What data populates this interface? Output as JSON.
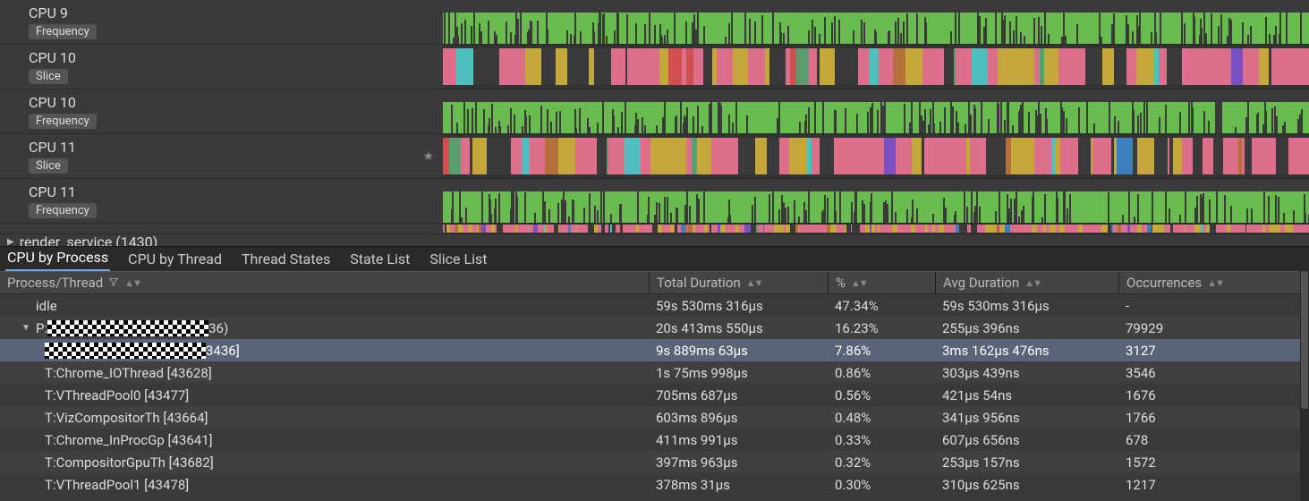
{
  "tracks": [
    {
      "title": "CPU 9",
      "badge": "Frequency",
      "type": "freq"
    },
    {
      "title": "CPU 10",
      "badge": "Slice",
      "type": "slice"
    },
    {
      "title": "CPU 10",
      "badge": "Frequency",
      "type": "freq"
    },
    {
      "title": "CPU 11",
      "badge": "Slice",
      "type": "slice",
      "starred": true
    },
    {
      "title": "CPU 11",
      "badge": "Frequency",
      "type": "freq"
    }
  ],
  "render_row": "render_service (1430)",
  "tabs": {
    "items": [
      "CPU by Process",
      "CPU by Thread",
      "Thread States",
      "State List",
      "Slice List"
    ],
    "active": 0
  },
  "columns": {
    "name": "Process/Thread",
    "dur": "Total Duration",
    "pct": "%",
    "avg": "Avg Duration",
    "occ": "Occurrences"
  },
  "rows": [
    {
      "name": "idle",
      "dur": "59s 530ms 316µs",
      "pct": "47.34%",
      "avg": "59s 530ms 316µs",
      "occ": "-",
      "depth": 1,
      "expander": "",
      "selected": false
    },
    {
      "name_prefix": "P:",
      "redacted": true,
      "name_suffix": "36)",
      "dur": "20s 413ms 550µs",
      "pct": "16.23%",
      "avg": "255µs 396ns",
      "occ": "79929",
      "depth": 1,
      "expander": "▼",
      "selected": false
    },
    {
      "name_prefix": "",
      "redacted": true,
      "name_suffix": "3436]",
      "dur": "9s 889ms 63µs",
      "pct": "7.86%",
      "avg": "3ms 162µs 476ns",
      "occ": "3127",
      "depth": 2,
      "expander": "",
      "selected": true
    },
    {
      "name": "T:Chrome_IOThread [43628]",
      "dur": "1s 75ms 998µs",
      "pct": "0.86%",
      "avg": "303µs 439ns",
      "occ": "3546",
      "depth": 2,
      "expander": "",
      "selected": false
    },
    {
      "name": "T:VThreadPool0 [43477]",
      "dur": "705ms 687µs",
      "pct": "0.56%",
      "avg": "421µs 54ns",
      "occ": "1676",
      "depth": 2,
      "expander": "",
      "selected": false
    },
    {
      "name": "T:VizCompositorTh [43664]",
      "dur": "603ms 896µs",
      "pct": "0.48%",
      "avg": "341µs 956ns",
      "occ": "1766",
      "depth": 2,
      "expander": "",
      "selected": false
    },
    {
      "name": "T:Chrome_InProcGp [43641]",
      "dur": "411ms 991µs",
      "pct": "0.33%",
      "avg": "607µs 656ns",
      "occ": "678",
      "depth": 2,
      "expander": "",
      "selected": false
    },
    {
      "name": "T:CompositorGpuTh [43682]",
      "dur": "397ms 963µs",
      "pct": "0.32%",
      "avg": "253µs 157ns",
      "occ": "1572",
      "depth": 2,
      "expander": "",
      "selected": false
    },
    {
      "name": "T:VThreadPool1 [43478]",
      "dur": "378ms 31µs",
      "pct": "0.30%",
      "avg": "310µs 625ns",
      "occ": "1217",
      "depth": 2,
      "expander": "",
      "selected": false
    }
  ],
  "slice_palette": [
    "#dd6f8d",
    "#c4a93a",
    "#3a3a3a",
    "#5a9e6f",
    "#3f7fbf",
    "#b56f3a",
    "#7a4fbf",
    "#d04f4f",
    "#4fbfbf"
  ]
}
